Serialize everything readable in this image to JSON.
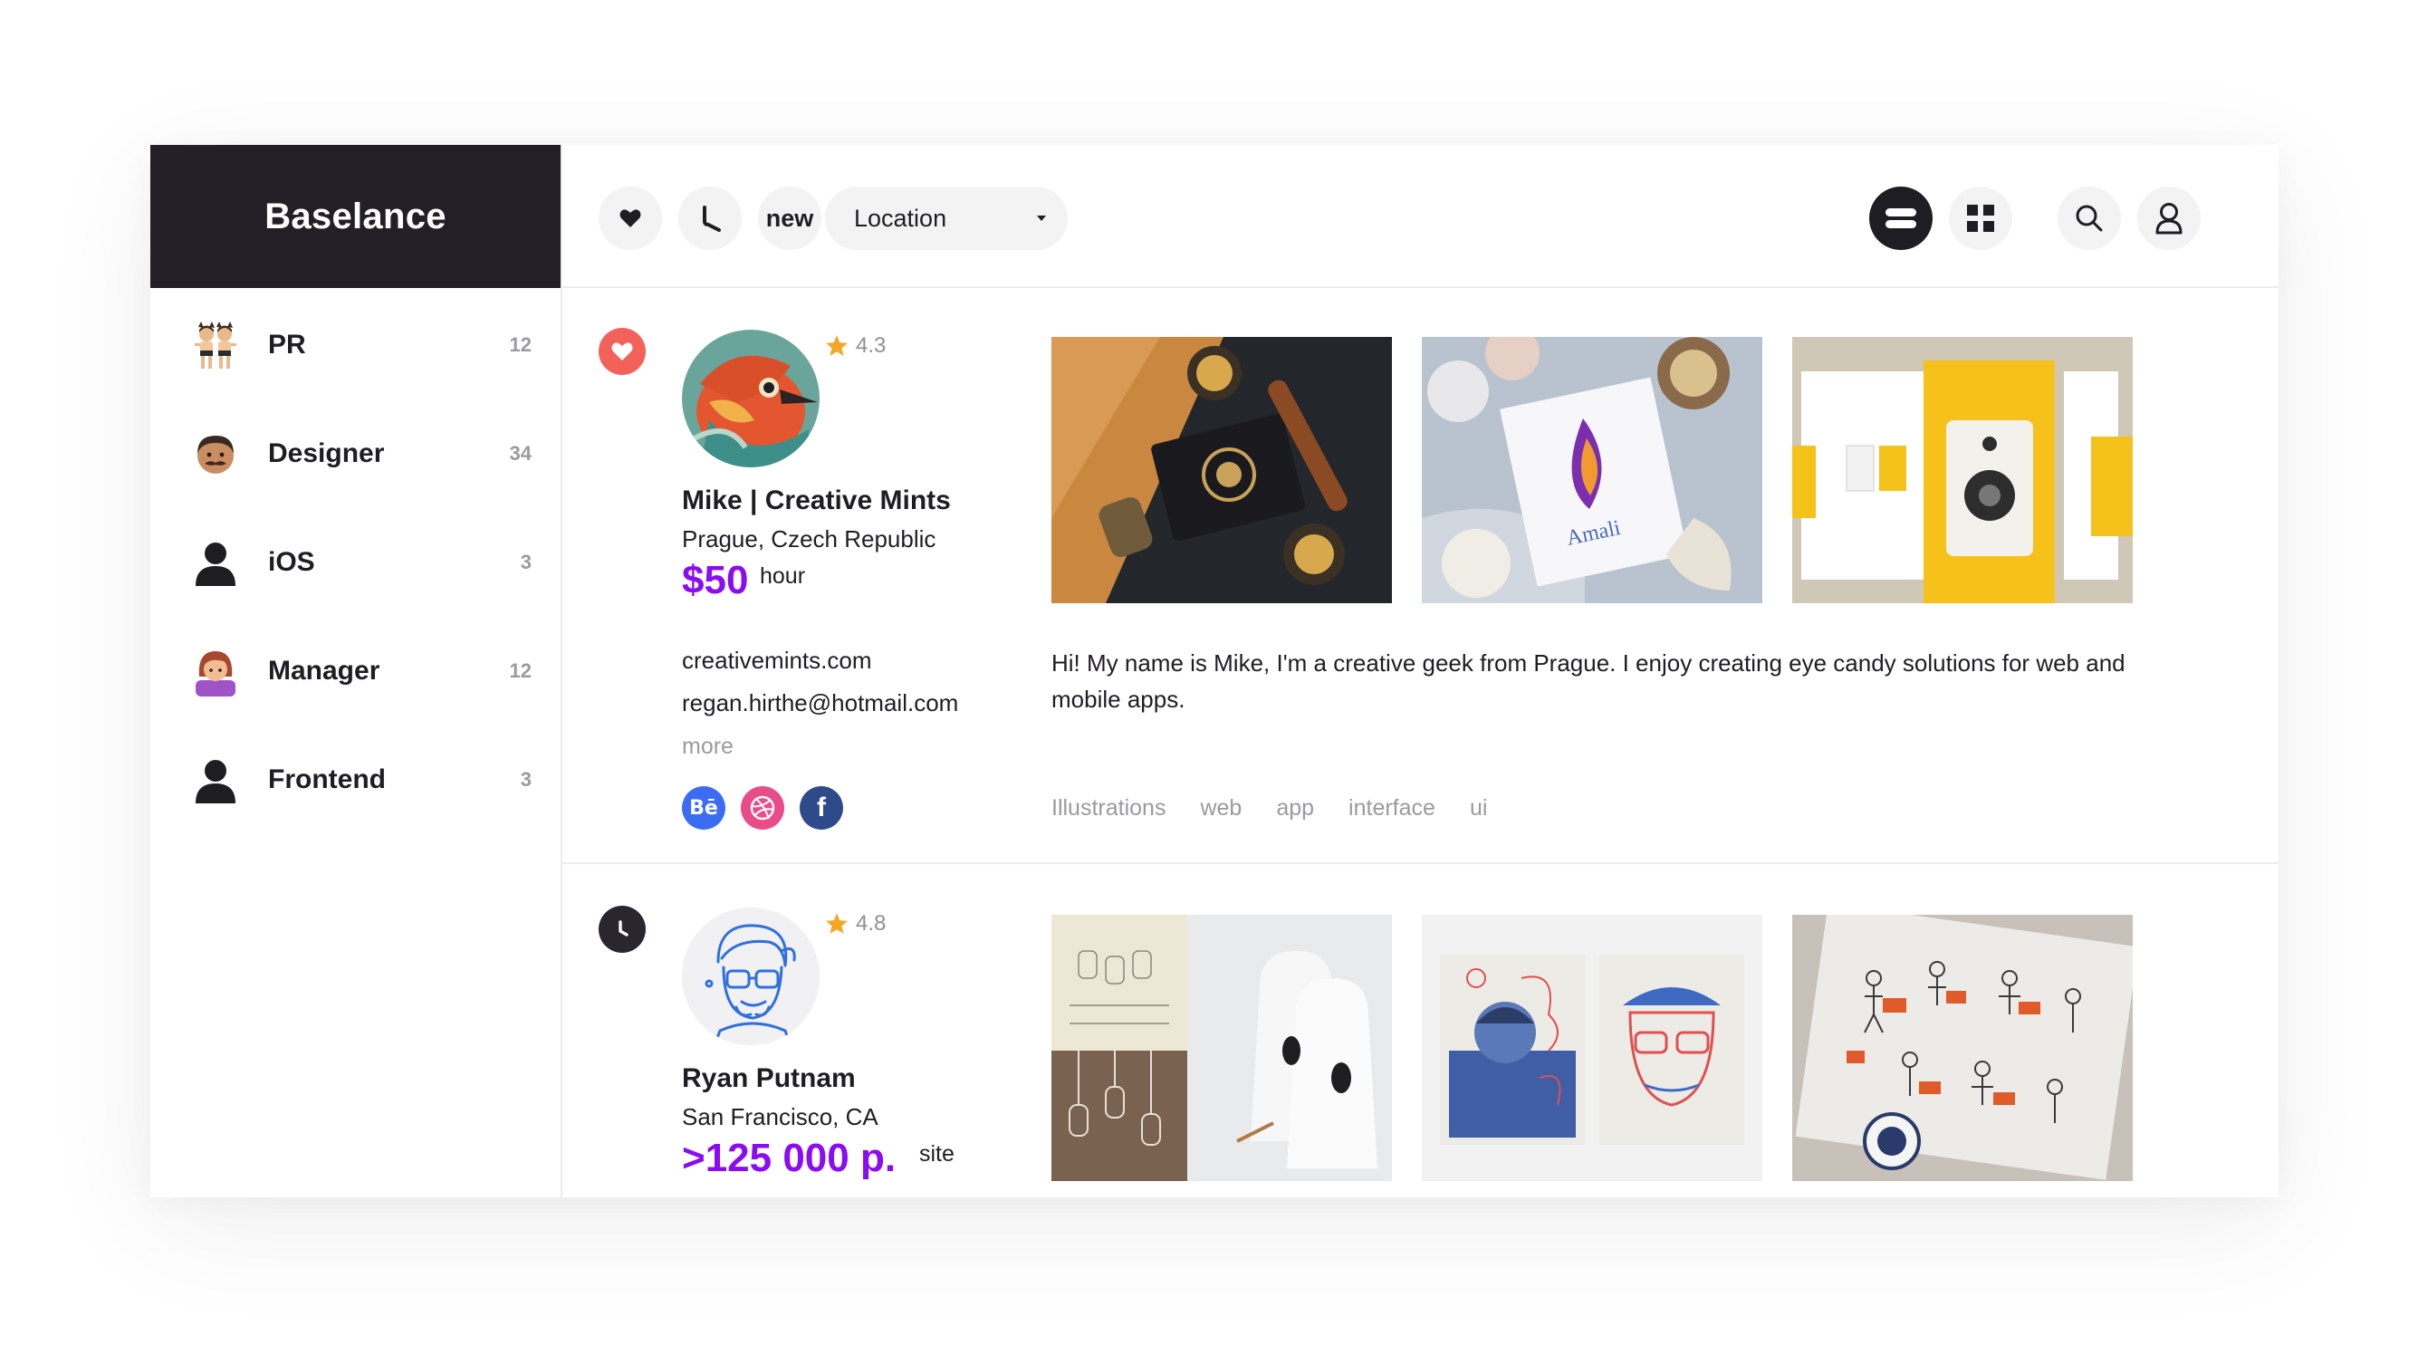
{
  "app": {
    "title": "Baselance"
  },
  "sidebar": {
    "items": [
      {
        "label": "PR",
        "count": "12",
        "icon": "dancers-emoji-icon"
      },
      {
        "label": "Designer",
        "count": "34",
        "icon": "man-mustache-emoji-icon"
      },
      {
        "label": "iOS",
        "count": "3",
        "icon": "person-silhouette-icon"
      },
      {
        "label": "Manager",
        "count": "12",
        "icon": "woman-emoji-icon"
      },
      {
        "label": "Frontend",
        "count": "3",
        "icon": "person-silhouette-icon"
      }
    ]
  },
  "toolbar": {
    "favorites_icon": "heart-icon",
    "recent_icon": "clock-icon",
    "new_label": "new",
    "location": {
      "selected": "Location"
    },
    "list_view_icon": "list-view-icon",
    "grid_view_icon": "grid-view-icon",
    "search_icon": "search-icon",
    "profile_icon": "user-icon",
    "accent": "#1f1d24"
  },
  "freelancers": [
    {
      "status_icon": "heart-icon",
      "name": "Mike | Creative Mints",
      "location": "Prague, Czech Republic",
      "rating": "4.3",
      "price": "$50",
      "price_unit": "hour",
      "website": "creativemints.com",
      "email": "regan.hirthe@hotmail.com",
      "more_label": "more",
      "socials": [
        {
          "label": "Bē",
          "color": "#3b6cf2",
          "icon": "behance-icon"
        },
        {
          "label": "",
          "color": "#ea4c89",
          "icon": "dribbble-icon"
        },
        {
          "label": "f",
          "color": "#2f4a8a",
          "icon": "facebook-icon"
        }
      ],
      "portfolio_text": {
        "box_label": "Amali"
      },
      "bio": "Hi! My name is Mike, I'm a creative geek from Prague. I enjoy creating eye candy solutions for web and mobile apps.",
      "tags": [
        "Illustrations",
        "web",
        "app",
        "interface",
        "ui"
      ]
    },
    {
      "status_icon": "clock-icon",
      "name": "Ryan Putnam",
      "location": "San Francisco, CA",
      "rating": "4.8",
      "price": ">125 000 p.",
      "price_unit": "site"
    }
  ],
  "colors": {
    "price": "#8a0cf2",
    "favorite": "#f2625a",
    "star": "#f5a623",
    "sidebar_header": "#231f26"
  }
}
